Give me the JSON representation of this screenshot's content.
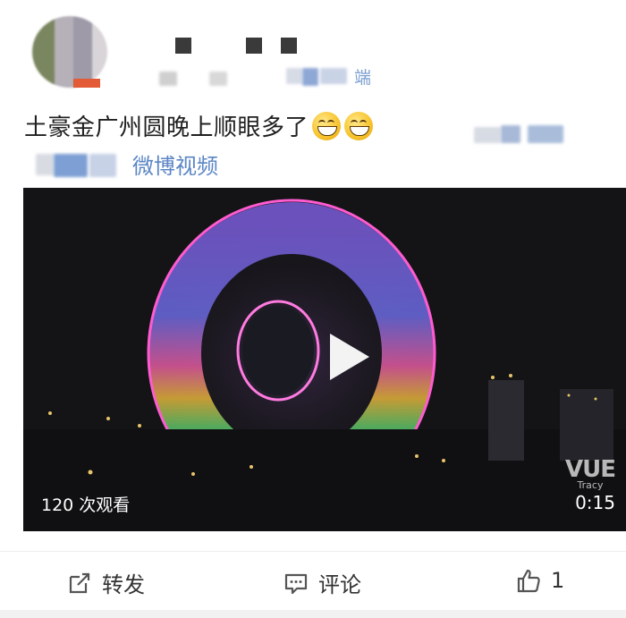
{
  "post": {
    "source_suffix": "端",
    "text": "土豪金广州圆晚上顺眼多了",
    "emojis": [
      "grin-emoji",
      "grin-emoji"
    ],
    "video_link_label": "微博视频"
  },
  "video": {
    "view_count_label": "120 次观看",
    "duration": "0:15",
    "watermark_logo": "VUE",
    "watermark_sub": "Tracy"
  },
  "actions": {
    "repost_label": "转发",
    "comment_label": "评论",
    "like_count": "1"
  },
  "colors": {
    "link": "#5b86c5",
    "source": "#7b9fd0",
    "video_bg": "#141416"
  }
}
